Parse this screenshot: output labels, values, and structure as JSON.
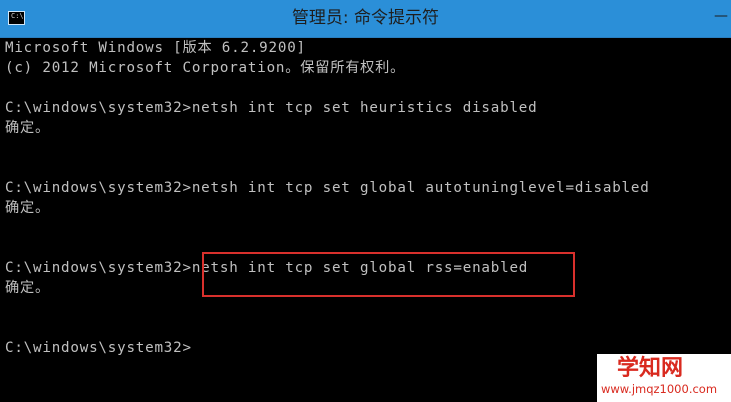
{
  "window": {
    "title": "管理员: 命令提示符",
    "icon_text": "C:\\",
    "minimize_glyph": "—"
  },
  "console": {
    "lines": [
      "Microsoft Windows [版本 6.2.9200]",
      "(c) 2012 Microsoft Corporation。保留所有权利。",
      "",
      "C:\\windows\\system32>netsh int tcp set heuristics disabled",
      "确定。",
      "",
      "",
      "C:\\windows\\system32>netsh int tcp set global autotuninglevel=disabled",
      "确定。",
      "",
      "",
      "C:\\windows\\system32>netsh int tcp set global rss=enabled",
      "确定。",
      "",
      "",
      "C:\\windows\\system32>"
    ]
  },
  "watermark": {
    "main": "学知网",
    "url": "www.jmqz1000.com"
  },
  "colors": {
    "titlebar": "#2b8fd8",
    "console_bg": "#000000",
    "console_text": "#c0c0c0",
    "highlight_border": "#d9302c",
    "watermark_text": "#d92a1f"
  }
}
